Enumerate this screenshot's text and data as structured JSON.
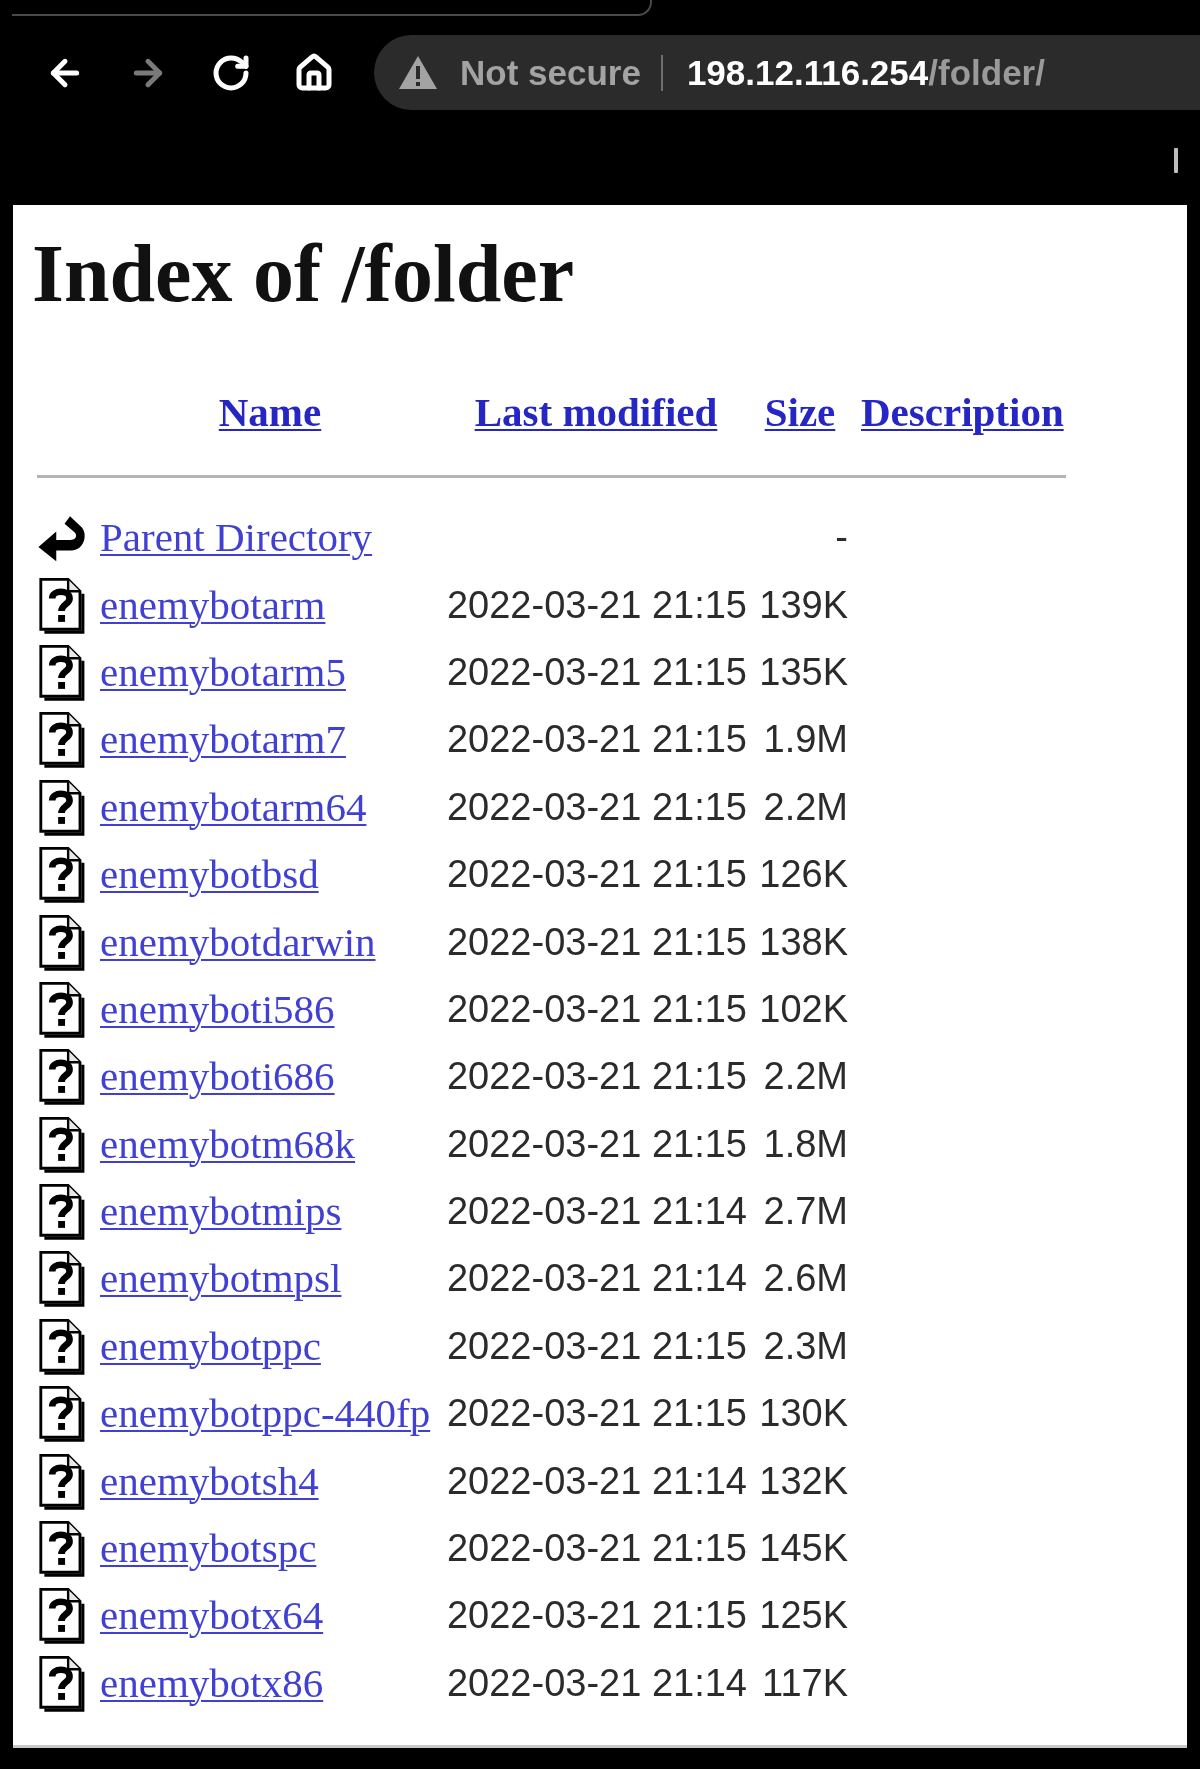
{
  "browser": {
    "nav_buttons": [
      {
        "kind": "back",
        "disabled": false
      },
      {
        "kind": "forward",
        "disabled": true
      },
      {
        "kind": "reload",
        "disabled": false
      },
      {
        "kind": "home",
        "disabled": false
      }
    ],
    "address_bar": {
      "security_label": "Not secure",
      "host": "198.12.116.254",
      "path": "/folder/"
    }
  },
  "page": {
    "title": "Index of /folder",
    "columns": [
      "Name",
      "Last modified",
      "Size",
      "Description"
    ],
    "rows": [
      {
        "kind": "parent",
        "name": "Parent Directory",
        "size": "-"
      },
      {
        "kind": "file",
        "name": "enemybotarm",
        "last_modified": "2022-03-21 21:15",
        "size": "139K"
      },
      {
        "kind": "file",
        "name": "enemybotarm5",
        "last_modified": "2022-03-21 21:15",
        "size": "135K"
      },
      {
        "kind": "file",
        "name": "enemybotarm7",
        "last_modified": "2022-03-21 21:15",
        "size": "1.9M"
      },
      {
        "kind": "file",
        "name": "enemybotarm64",
        "last_modified": "2022-03-21 21:15",
        "size": "2.2M"
      },
      {
        "kind": "file",
        "name": "enemybotbsd",
        "last_modified": "2022-03-21 21:15",
        "size": "126K"
      },
      {
        "kind": "file",
        "name": "enemybotdarwin",
        "last_modified": "2022-03-21 21:15",
        "size": "138K"
      },
      {
        "kind": "file",
        "name": "enemyboti586",
        "last_modified": "2022-03-21 21:15",
        "size": "102K"
      },
      {
        "kind": "file",
        "name": "enemyboti686",
        "last_modified": "2022-03-21 21:15",
        "size": "2.2M"
      },
      {
        "kind": "file",
        "name": "enemybotm68k",
        "last_modified": "2022-03-21 21:15",
        "size": "1.8M"
      },
      {
        "kind": "file",
        "name": "enemybotmips",
        "last_modified": "2022-03-21 21:14",
        "size": "2.7M"
      },
      {
        "kind": "file",
        "name": "enemybotmpsl",
        "last_modified": "2022-03-21 21:14",
        "size": "2.6M"
      },
      {
        "kind": "file",
        "name": "enemybotppc",
        "last_modified": "2022-03-21 21:15",
        "size": "2.3M"
      },
      {
        "kind": "file",
        "name": "enemybotppc-440fp",
        "last_modified": "2022-03-21 21:15",
        "size": "130K"
      },
      {
        "kind": "file",
        "name": "enemybotsh4",
        "last_modified": "2022-03-21 21:14",
        "size": "132K"
      },
      {
        "kind": "file",
        "name": "enemybotspc",
        "last_modified": "2022-03-21 21:15",
        "size": "145K"
      },
      {
        "kind": "file",
        "name": "enemybotx64",
        "last_modified": "2022-03-21 21:15",
        "size": "125K"
      },
      {
        "kind": "file",
        "name": "enemybotx86",
        "last_modified": "2022-03-21 21:14",
        "size": "117K"
      }
    ]
  }
}
